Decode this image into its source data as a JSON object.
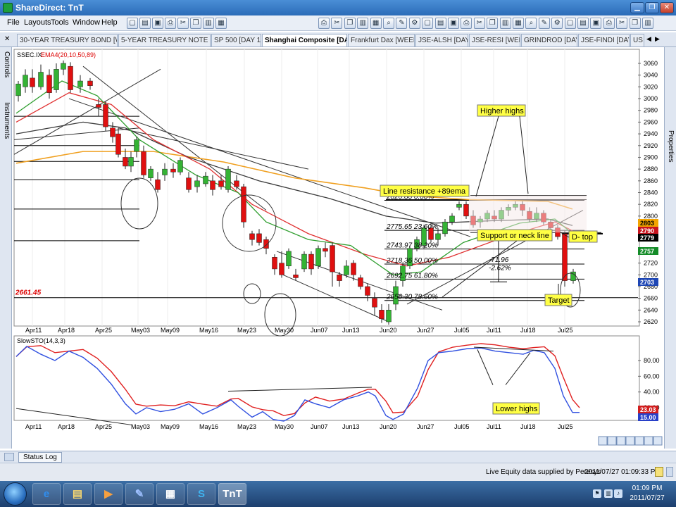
{
  "window": {
    "title": "ShareDirect: TnT"
  },
  "menu": [
    "File",
    "Layouts",
    "Tools",
    "Window",
    "Help"
  ],
  "toolbar_icons": [
    "new-icon",
    "open-icon",
    "save-icon",
    "print-icon",
    "cut-icon",
    "copy-icon",
    "paste-icon",
    "chart-icon",
    "zoom-icon",
    "draw-icon",
    "settings-icon"
  ],
  "tabs": [
    "30-YEAR TREASURY BOND [WEEK 1]",
    "5-YEAR TREASURY NOTE [DAY 1]",
    "SP 500 [DAY 1]",
    "Shanghai Composite [DAY 1]",
    "Frankfurt Dax [WEEK 1]",
    "JSE-ALSH [DAY 1]",
    "JSE-RESI [WEEK 1]",
    "GRINDROD [DAY 1]",
    "JSE-FINDI [DAY 1]",
    "US"
  ],
  "active_tab": 3,
  "side_panels": {
    "left": [
      "Controls",
      "Instruments"
    ],
    "right": [
      "Properties"
    ]
  },
  "chart": {
    "symbol": "SSEC.IX",
    "indicator": "EMA4(20,10,50,89)",
    "osc_label": "SlowSTO(14,3,3)",
    "y_ticks": [
      3060,
      3040,
      3020,
      3000,
      2980,
      2960,
      2940,
      2920,
      2900,
      2880,
      2860,
      2840,
      2820,
      2800,
      2780,
      2760,
      2740,
      2720,
      2700,
      2680,
      2660,
      2640,
      2620
    ],
    "date_labels": [
      "Apr11",
      "Apr18",
      "Apr25",
      "May03",
      "May09",
      "May16",
      "May23",
      "May30",
      "Jun07",
      "Jun13",
      "Jun20",
      "Jun27",
      "Jul05",
      "Jul11",
      "Jul18",
      "Jul25"
    ],
    "osc_ticks": [
      "80.00",
      "60.00",
      "40.00",
      "20.00"
    ],
    "price_badges": [
      {
        "text": "2803",
        "bg": "#f2a400",
        "fg": "#000"
      },
      {
        "text": "2790",
        "bg": "#c8141e",
        "fg": "#fff"
      },
      {
        "text": "2779",
        "bg": "#000000",
        "fg": "#fff"
      },
      {
        "text": "2757",
        "bg": "#148c28",
        "fg": "#fff"
      },
      {
        "text": "2703",
        "bg": "#1e46b4",
        "fg": "#fff"
      }
    ],
    "osc_badges": [
      {
        "text": "23.03",
        "bg": "#d21e1e"
      },
      {
        "text": "15.00",
        "bg": "#2840c8"
      }
    ],
    "level_label": "2661.45",
    "fib_levels": [
      "2826.86 0.00%",
      "2775.65 23.60%",
      "2743.97 38.20%",
      "2718.36 50.00%",
      "2692.75 61.80%",
      "2656.30 78.60%"
    ],
    "measure": [
      "-71.96",
      "-2.62%"
    ],
    "callouts": {
      "higher_highs": "Higher highs",
      "line_resistance": "Line resistance +89ema",
      "support_neck": "Support or neck line",
      "d_top": "D- top",
      "target": "Target",
      "lower_highs": "Lower highs"
    },
    "colors": {
      "up": "#34b334",
      "down": "#e01010",
      "ema10": "#2f9e2f",
      "ema20": "#e03030",
      "ema50": "#3a3a3a",
      "ema89": "#f0a020",
      "sto_k": "#3050e0",
      "sto_d": "#e02020",
      "callout": "#ffff44"
    }
  },
  "status": {
    "log_button": "Status Log",
    "live_data": "Live Equity data supplied by Peresys",
    "timestamp": "2011/07/27 01:09:33 PM"
  },
  "taskbar": {
    "time": "01:09 PM",
    "date": "2011/07/27"
  }
}
